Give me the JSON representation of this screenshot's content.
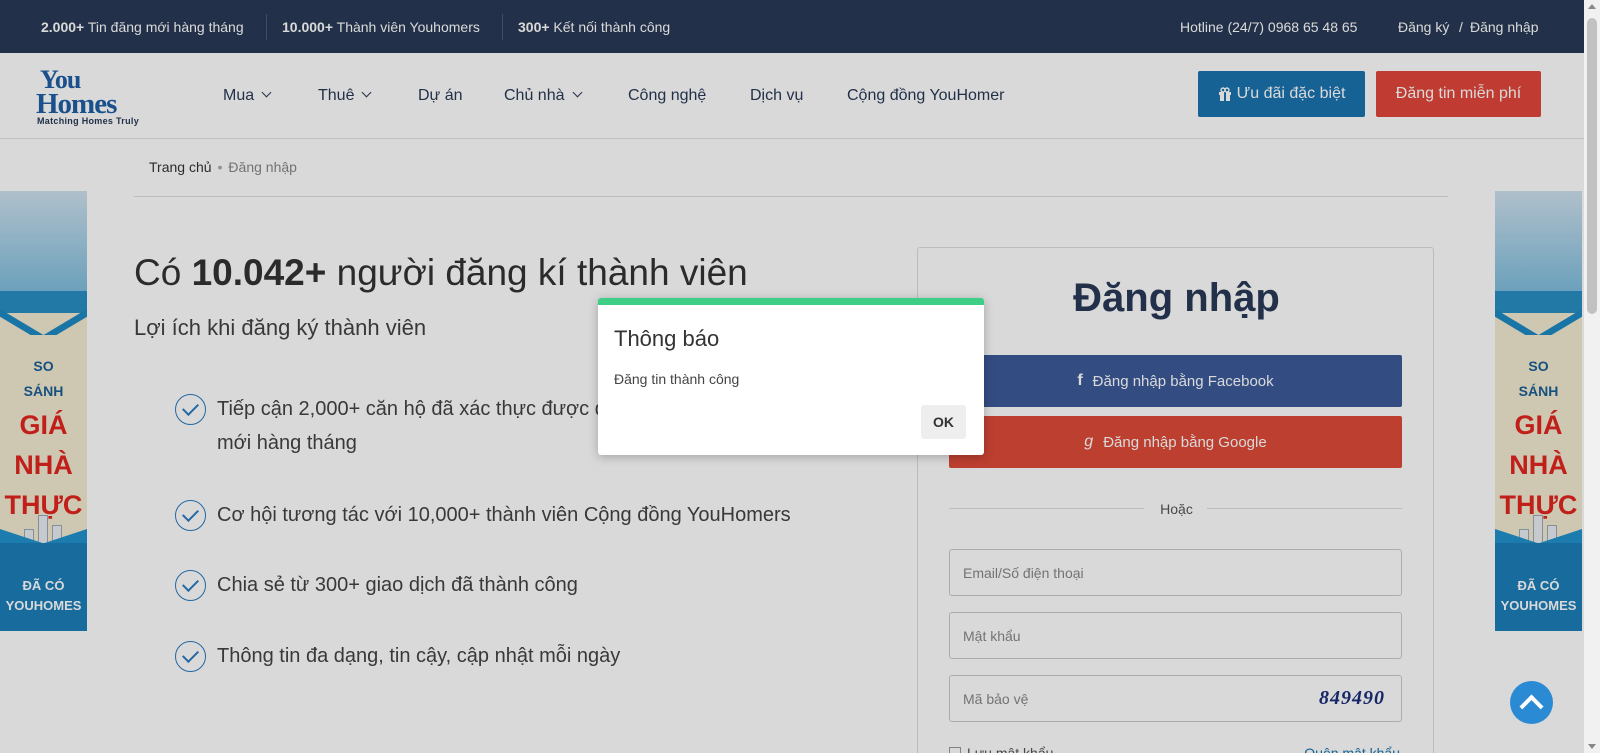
{
  "topbar": {
    "stats": [
      {
        "num": "2.000+",
        "text": " Tin đăng mới hàng tháng"
      },
      {
        "num": "10.000+",
        "text": " Thành viên Youhomers"
      },
      {
        "num": "300+",
        "text": " Kết nối thành công"
      }
    ],
    "hotline": "Hotline (24/7) 0968 65 48 65",
    "register": "Đăng ký",
    "divider": "/",
    "login": "Đăng nhập"
  },
  "logo": {
    "line1": "You",
    "line2": "Homes",
    "tagline": "Matching Homes Truly"
  },
  "nav": [
    "Mua",
    "Thuê",
    "Dự án",
    "Chủ nhà",
    "Công nghệ",
    "Dịch vụ",
    "Cộng đồng YouHomer"
  ],
  "header_buttons": {
    "deal": "Ưu đãi đặc biệt",
    "deal_icon": "gift-icon",
    "post": "Đăng tin miễn phí"
  },
  "breadcrumb": {
    "home": "Trang chủ",
    "sep": "•",
    "current": "Đăng nhập"
  },
  "banner": {
    "line1": "SO",
    "line2": "SÁNH",
    "line3": "GIÁ",
    "line4": "NHÀ",
    "line5": "THỰC",
    "line6": "ĐÃ CÓ",
    "line7": "YOUHOMES"
  },
  "main": {
    "headline_prefix": "Có ",
    "headline_count": "10.042+",
    "headline_suffix": " người đăng kí thành viên",
    "subhead": "Lợi ích khi đăng ký thành viên",
    "benefits": [
      {
        "line1": "Tiếp cận 2,000+ căn hộ đã xác thực được đăng",
        "line2": "mới hàng tháng"
      },
      {
        "line1": "Cơ hội tương tác với 10,000+ thành viên Cộng đồng YouHomers"
      },
      {
        "line1": "Chia sẻ từ 300+ giao dịch đã thành công"
      },
      {
        "line1": "Thông tin đa dạng, tin cậy, cập nhật mỗi ngày"
      }
    ]
  },
  "login": {
    "title": "Đăng nhập",
    "facebook": "Đăng nhập bằng Facebook",
    "facebook_icon": "f",
    "google": "Đăng nhập bằng Google",
    "google_icon": "g",
    "or": "Hoặc",
    "email_placeholder": "Email/Số điện thoại",
    "password_placeholder": "Mật khẩu",
    "captcha_placeholder": "Mã bảo vệ",
    "captcha_code": "849490",
    "remember": "Lưu mật khẩu",
    "forgot": "Quên mật khẩu"
  },
  "modal": {
    "title": "Thông báo",
    "message": "Đăng tin thành công",
    "ok": "OK"
  },
  "colors": {
    "topbar": "#293a56",
    "primary": "#1b74b0",
    "danger": "#e2463a",
    "facebook": "#3c5a99",
    "google": "#dd4b39",
    "modal_accent": "#3dcf85"
  }
}
